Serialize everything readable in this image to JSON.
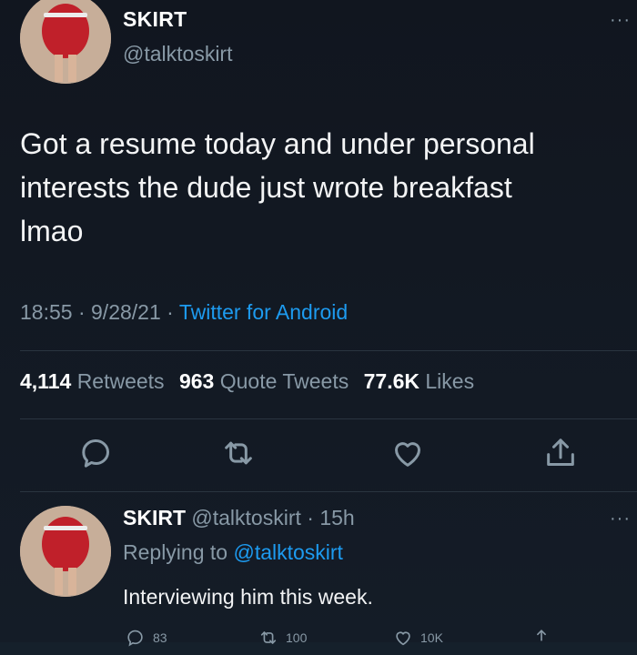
{
  "tweet": {
    "author_name": "SKIRT",
    "author_handle": "@talktoskirt",
    "more_label": "···",
    "text": "Got a resume today and under personal\ninterests the dude just wrote breakfast\nlmao",
    "time": "18:55",
    "separator": "·",
    "date": "9/28/21",
    "source": "Twitter for Android",
    "retweets_count": "4,114",
    "retweets_label": "Retweets",
    "quote_count": "963",
    "quote_label": "Quote Tweets",
    "likes_count": "77.6K",
    "likes_label": "Likes",
    "actions": [
      {
        "icon": "reply-icon"
      },
      {
        "icon": "retweet-icon"
      },
      {
        "icon": "like-icon"
      },
      {
        "icon": "share-icon"
      }
    ]
  },
  "reply": {
    "author_name": "SKIRT",
    "author_handle": "@talktoskirt",
    "separator": "·",
    "age": "15h",
    "more_label": "···",
    "replying_prefix": "Replying to",
    "replying_handle": "@talktoskirt",
    "text": "Interviewing him this week.",
    "reply_count": "83",
    "retweet_count": "100",
    "like_count": "10K"
  },
  "colors": {
    "background": "#141c27",
    "text": "#ffffff",
    "muted": "#8899a6",
    "link": "#1d9bf0",
    "divider": "#2a3540"
  }
}
